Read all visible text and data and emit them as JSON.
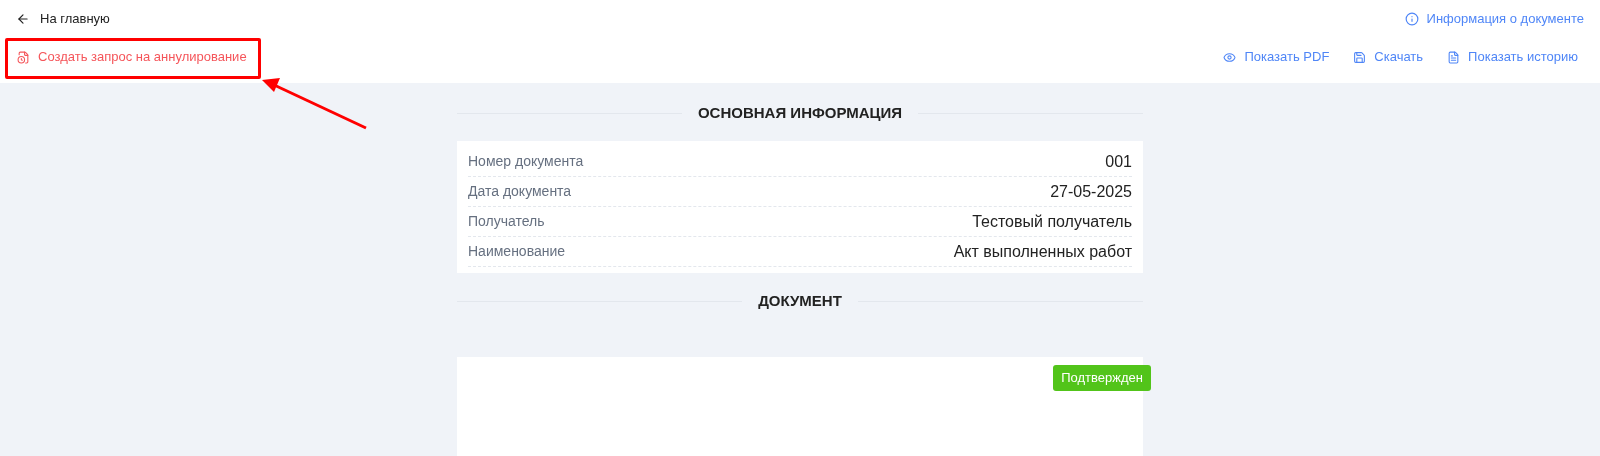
{
  "header": {
    "back_link": "На главную",
    "info_link": "Информация о документе",
    "cancel_request_button": "Создать запрос на аннулирование",
    "actions": [
      {
        "kind": "eye",
        "label": "Показать PDF"
      },
      {
        "kind": "save",
        "label": "Скачать"
      },
      {
        "kind": "history",
        "label": "Показать историю"
      }
    ]
  },
  "main_info": {
    "title": "ОСНОВНАЯ ИНФОРМАЦИЯ",
    "fields": [
      {
        "label": "Номер документа",
        "value": "001"
      },
      {
        "label": "Дата документа",
        "value": "27-05-2025"
      },
      {
        "label": "Получатель",
        "value": "Тестовый получатель"
      },
      {
        "label": "Наименование",
        "value": "Акт выполненных работ"
      }
    ]
  },
  "document": {
    "title": "ДОКУМЕНТ",
    "status": "Подтвержден"
  }
}
